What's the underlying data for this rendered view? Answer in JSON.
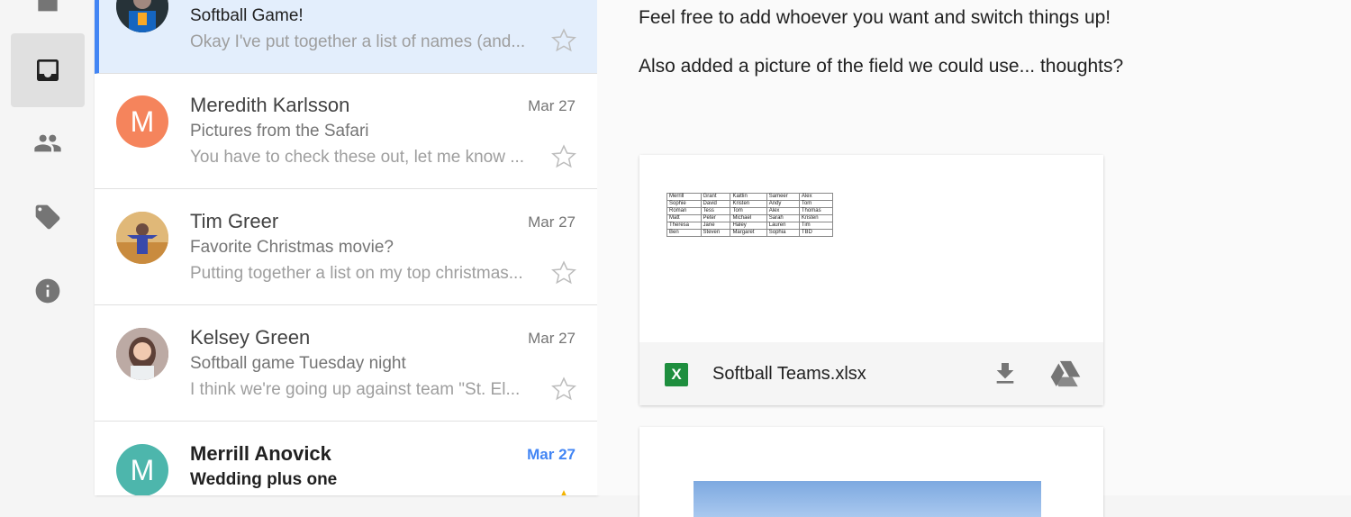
{
  "rail": {
    "items": [
      {
        "icon": "camera-icon"
      },
      {
        "icon": "inbox-icon",
        "active": true
      },
      {
        "icon": "contacts-icon"
      },
      {
        "icon": "label-icon"
      },
      {
        "icon": "info-icon"
      }
    ]
  },
  "messages": [
    {
      "sender": "",
      "date": "",
      "subject": "Softball Game!",
      "snippet": "Okay I've put together a list of names (and...",
      "avatar_letter": "",
      "avatar_color": "#37474f",
      "selected": true,
      "unread": false
    },
    {
      "sender": "Meredith Karlsson",
      "date": "Mar 27",
      "subject": "Pictures from the Safari",
      "snippet": "You have to check these out, let me know ...",
      "avatar_letter": "M",
      "avatar_color": "#f5845c",
      "selected": false,
      "unread": false
    },
    {
      "sender": "Tim Greer",
      "date": "Mar 27",
      "subject": "Favorite Christmas movie?",
      "snippet": "Putting together a list on my top christmas...",
      "avatar_letter": "",
      "avatar_color": "#d8a35a",
      "selected": false,
      "unread": false
    },
    {
      "sender": "Kelsey Green",
      "date": "Mar 27",
      "subject": "Softball game Tuesday night",
      "snippet": "I think we're going up against team \"St. El...",
      "avatar_letter": "",
      "avatar_color": "#8d6e63",
      "selected": false,
      "unread": false
    },
    {
      "sender": "Merrill Anovick",
      "date": "Mar 27",
      "subject": "Wedding plus one",
      "snippet": "",
      "avatar_letter": "M",
      "avatar_color": "#4db6ac",
      "selected": false,
      "unread": true
    }
  ],
  "pane": {
    "line1": "Feel free to add whoever you want and switch things up!",
    "line2": "Also added a picture of the field we could use... thoughts?",
    "attachment": {
      "icon_letter": "X",
      "filename": "Softball Teams.xlsx",
      "sheet": [
        [
          "Merrill",
          "Grant",
          "Kaitlin",
          "Sameer",
          "Alex"
        ],
        [
          "Sophie",
          "David",
          "Kristen",
          "Andy",
          "Tom"
        ],
        [
          "Roman",
          "Tess",
          "Tom",
          "Alex",
          "Thomas"
        ],
        [
          "Matt",
          "Peter",
          "Michael",
          "Sarah",
          "Kristen"
        ],
        [
          "Theresa",
          "Jane",
          "Haley",
          "Lauren",
          "Tim"
        ],
        [
          "Ben",
          "Steven",
          "Margaret",
          "Sophia",
          "TBD"
        ]
      ]
    }
  },
  "colors": {
    "accent": "#4285f4",
    "selected_bg": "#e3eefc",
    "excel_green": "#1e8e3e"
  }
}
